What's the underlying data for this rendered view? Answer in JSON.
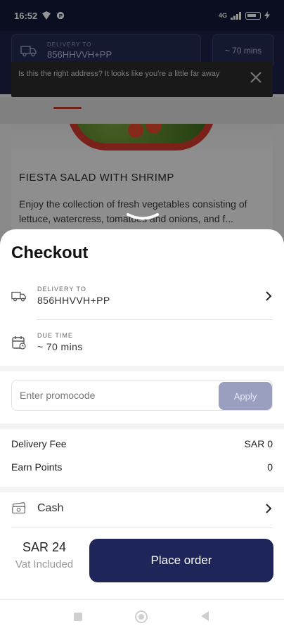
{
  "status_bar": {
    "time": "16:52",
    "network": "4G",
    "signal": "ull"
  },
  "background": {
    "delivery_to_label": "DELIVERY TO",
    "delivery_to_value": "856HHVVH+PP",
    "time_label": "~ 70 mins",
    "far_warning": "Is this the right address? It looks like you're a little far away",
    "item_name": "FIESTA SALAD WITH SHRIMP",
    "item_desc": "Enjoy the collection of fresh vegetables consisting of lettuce, watercress, tomatoes and onions, and f..."
  },
  "checkout": {
    "title": "Checkout",
    "delivery": {
      "label": "DELIVERY TO",
      "value": "856HHVVH+PP",
      "icon": "truck-icon"
    },
    "due": {
      "label": "DUE TIME",
      "value": "~ 70 mins",
      "icon": "calendar-icon"
    },
    "promo": {
      "placeholder": "Enter promocode",
      "apply_label": "Apply"
    },
    "fees": [
      {
        "label": "Delivery Fee",
        "value": "SAR 0"
      },
      {
        "label": "Earn Points",
        "value": "0"
      }
    ],
    "payment": {
      "label": "Cash",
      "icon": "cash-icon"
    },
    "total": {
      "amount": "SAR 24",
      "note": "Vat Included"
    },
    "place_order": "Place order"
  },
  "colors": {
    "primary": "#1e2558",
    "apply_disabled": "#9a9ebf",
    "accent": "#c0392b"
  }
}
